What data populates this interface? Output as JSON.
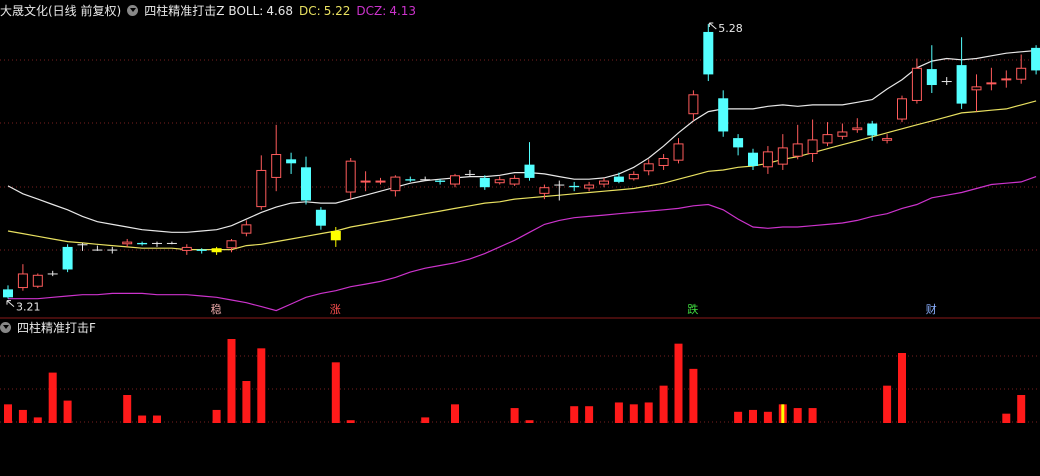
{
  "header": {
    "title": "大晟文化(日线 前复权)",
    "indicator_name": "四柱精准打击Z",
    "boll_label": "BOLL:",
    "boll_value": "4.68",
    "dc_label": "DC:",
    "dc_value": "5.22",
    "dcz_label": "DCZ:",
    "dcz_value": "4.13"
  },
  "sub_header": {
    "indicator_name": "四柱精准打击F"
  },
  "colors": {
    "up": "#ff5c5c",
    "down": "#54ffff",
    "signal": "#ffff00",
    "boll": "#e8e8e8",
    "dc": "#e8e060",
    "dcz": "#cc33cc",
    "volume": "#ff1a1a"
  },
  "markers": [
    {
      "text": "稳",
      "index": 14,
      "color": "#e8a8a8"
    },
    {
      "text": "涨",
      "index": 22,
      "color": "#ff5050"
    },
    {
      "text": "跌",
      "index": 46,
      "color": "#40dd40"
    },
    {
      "text": "财",
      "index": 62,
      "color": "#8ab0ff"
    }
  ],
  "chart_data": [
    {
      "type": "candlestick",
      "price_range": [
        3.2,
        5.31
      ],
      "annotations": {
        "high_label": "5.28",
        "low_label": "3.21"
      },
      "candles": [
        [
          3.28,
          3.22,
          3.31,
          3.21
        ],
        [
          3.29,
          3.4,
          3.47,
          3.27
        ],
        [
          3.3,
          3.39,
          3.4,
          3.29
        ],
        [
          3.4,
          3.4,
          3.42,
          3.38
        ],
        [
          3.6,
          3.43,
          3.62,
          3.41
        ],
        [
          3.62,
          3.62,
          3.63,
          3.57
        ],
        [
          3.58,
          3.58,
          3.61,
          3.57
        ],
        [
          3.58,
          3.58,
          3.6,
          3.55
        ],
        [
          3.62,
          3.64,
          3.66,
          3.6
        ],
        [
          3.63,
          3.62,
          3.64,
          3.61
        ],
        [
          3.63,
          3.63,
          3.64,
          3.6
        ],
        [
          3.63,
          3.63,
          3.64,
          3.62
        ],
        [
          3.57,
          3.6,
          3.62,
          3.54
        ],
        [
          3.58,
          3.57,
          3.59,
          3.55
        ],
        [
          3.59,
          3.56,
          3.6,
          3.54
        ],
        [
          3.59,
          3.65,
          3.66,
          3.56
        ],
        [
          3.7,
          3.77,
          3.8,
          3.68
        ],
        [
          3.9,
          4.18,
          4.29,
          3.88
        ],
        [
          4.12,
          4.3,
          4.52,
          4.02
        ],
        [
          4.26,
          4.23,
          4.31,
          4.15
        ],
        [
          4.2,
          3.95,
          4.28,
          3.92
        ],
        [
          3.88,
          3.76,
          3.9,
          3.73
        ],
        [
          3.72,
          3.65,
          3.75,
          3.6
        ],
        [
          4.01,
          4.25,
          4.27,
          3.96
        ],
        [
          4.09,
          4.1,
          4.17,
          4.02
        ],
        [
          4.09,
          4.1,
          4.12,
          4.07
        ],
        [
          4.02,
          4.13,
          4.14,
          3.98
        ],
        [
          4.11,
          4.1,
          4.13,
          4.09
        ],
        [
          4.11,
          4.11,
          4.13,
          4.1
        ],
        [
          4.1,
          4.09,
          4.11,
          4.07
        ],
        [
          4.07,
          4.14,
          4.15,
          4.05
        ],
        [
          4.15,
          4.15,
          4.18,
          4.13
        ],
        [
          4.12,
          4.05,
          4.14,
          4.03
        ],
        [
          4.08,
          4.11,
          4.13,
          4.07
        ],
        [
          4.07,
          4.12,
          4.14,
          4.06
        ],
        [
          4.22,
          4.12,
          4.39,
          4.1
        ],
        [
          4.0,
          4.05,
          4.07,
          3.96
        ],
        [
          4.07,
          4.07,
          4.1,
          3.95
        ],
        [
          4.06,
          4.05,
          4.09,
          4.02
        ],
        [
          4.04,
          4.07,
          4.09,
          4.02
        ],
        [
          4.07,
          4.1,
          4.12,
          4.05
        ],
        [
          4.13,
          4.09,
          4.16,
          4.08
        ],
        [
          4.11,
          4.15,
          4.17,
          4.1
        ],
        [
          4.17,
          4.23,
          4.26,
          4.14
        ],
        [
          4.21,
          4.27,
          4.3,
          4.18
        ],
        [
          4.25,
          4.38,
          4.42,
          4.23
        ],
        [
          4.6,
          4.75,
          4.78,
          4.55
        ],
        [
          5.22,
          4.9,
          5.28,
          4.85
        ],
        [
          4.72,
          4.47,
          4.78,
          4.43
        ],
        [
          4.42,
          4.35,
          4.45,
          4.29
        ],
        [
          4.31,
          4.21,
          4.34,
          4.18
        ],
        [
          4.2,
          4.32,
          4.36,
          4.15
        ],
        [
          4.22,
          4.35,
          4.45,
          4.18
        ],
        [
          4.28,
          4.38,
          4.52,
          4.26
        ],
        [
          4.3,
          4.41,
          4.56,
          4.24
        ],
        [
          4.38,
          4.45,
          4.54,
          4.36
        ],
        [
          4.43,
          4.47,
          4.53,
          4.41
        ],
        [
          4.48,
          4.5,
          4.57,
          4.46
        ],
        [
          4.53,
          4.44,
          4.55,
          4.4
        ],
        [
          4.4,
          4.42,
          4.45,
          4.38
        ],
        [
          4.56,
          4.72,
          4.74,
          4.54
        ],
        [
          4.7,
          4.95,
          5.02,
          4.68
        ],
        [
          4.94,
          4.82,
          5.12,
          4.76
        ],
        [
          4.85,
          4.85,
          4.88,
          4.82
        ],
        [
          4.97,
          4.68,
          5.18,
          4.64
        ],
        [
          4.78,
          4.81,
          4.9,
          4.62
        ],
        [
          4.83,
          4.84,
          4.95,
          4.78
        ],
        [
          4.86,
          4.87,
          4.93,
          4.8
        ],
        [
          4.86,
          4.95,
          5.05,
          4.83
        ],
        [
          5.1,
          4.93,
          5.12,
          4.9
        ]
      ],
      "signal_candles": [
        14,
        22
      ],
      "lines": [
        {
          "name": "BOLL",
          "values": [
            4.06,
            4.0,
            3.96,
            3.92,
            3.88,
            3.83,
            3.79,
            3.77,
            3.75,
            3.73,
            3.72,
            3.71,
            3.71,
            3.72,
            3.73,
            3.76,
            3.81,
            3.86,
            3.9,
            3.93,
            3.94,
            3.93,
            3.93,
            3.96,
            3.99,
            4.02,
            4.05,
            4.08,
            4.1,
            4.11,
            4.12,
            4.13,
            4.13,
            4.14,
            4.16,
            4.16,
            4.15,
            4.13,
            4.11,
            4.11,
            4.12,
            4.15,
            4.2,
            4.27,
            4.36,
            4.46,
            4.55,
            4.62,
            4.64,
            4.64,
            4.64,
            4.66,
            4.67,
            4.66,
            4.67,
            4.67,
            4.67,
            4.69,
            4.71,
            4.79,
            4.86,
            4.95,
            5.0,
            5.02,
            5.01,
            5.02,
            5.04,
            5.06,
            5.07,
            5.08
          ]
        },
        {
          "name": "DC",
          "values": [
            3.72,
            3.7,
            3.68,
            3.66,
            3.64,
            3.63,
            3.62,
            3.61,
            3.6,
            3.59,
            3.59,
            3.59,
            3.58,
            3.58,
            3.58,
            3.58,
            3.61,
            3.62,
            3.64,
            3.66,
            3.68,
            3.7,
            3.72,
            3.75,
            3.77,
            3.79,
            3.81,
            3.83,
            3.85,
            3.87,
            3.89,
            3.91,
            3.93,
            3.94,
            3.96,
            3.97,
            3.98,
            3.99,
            4.0,
            4.01,
            4.02,
            4.03,
            4.04,
            4.06,
            4.08,
            4.11,
            4.14,
            4.17,
            4.18,
            4.2,
            4.21,
            4.23,
            4.26,
            4.28,
            4.31,
            4.34,
            4.37,
            4.4,
            4.43,
            4.46,
            4.49,
            4.52,
            4.55,
            4.58,
            4.61,
            4.62,
            4.63,
            4.64,
            4.67,
            4.7
          ]
        },
        {
          "name": "DCZ",
          "values": [
            3.21,
            3.21,
            3.21,
            3.22,
            3.23,
            3.24,
            3.24,
            3.25,
            3.25,
            3.25,
            3.24,
            3.24,
            3.24,
            3.23,
            3.22,
            3.2,
            3.18,
            3.15,
            3.12,
            3.17,
            3.22,
            3.25,
            3.27,
            3.3,
            3.32,
            3.34,
            3.37,
            3.41,
            3.44,
            3.46,
            3.48,
            3.51,
            3.55,
            3.6,
            3.65,
            3.71,
            3.77,
            3.8,
            3.82,
            3.83,
            3.84,
            3.85,
            3.86,
            3.87,
            3.88,
            3.89,
            3.91,
            3.92,
            3.88,
            3.81,
            3.75,
            3.74,
            3.75,
            3.75,
            3.76,
            3.77,
            3.78,
            3.8,
            3.83,
            3.85,
            3.89,
            3.92,
            3.97,
            3.99,
            4.01,
            4.04,
            4.07,
            4.08,
            4.09,
            4.13
          ]
        }
      ]
    },
    {
      "type": "bar",
      "name": "四柱精准打击F",
      "y_range": [
        0,
        90
      ],
      "values": [
        20,
        14,
        6,
        54,
        24,
        0,
        0,
        0,
        30,
        8,
        8,
        0,
        0,
        0,
        14,
        90,
        45,
        80,
        0,
        0,
        0,
        0,
        65,
        3,
        0,
        0,
        0,
        0,
        6,
        0,
        20,
        0,
        0,
        0,
        16,
        3,
        0,
        0,
        18,
        18,
        0,
        22,
        20,
        22,
        40,
        85,
        58,
        0,
        0,
        12,
        14,
        12,
        20,
        16,
        16,
        0,
        0,
        0,
        0,
        40,
        75,
        0,
        0,
        0,
        0,
        0,
        0,
        10,
        30,
        0
      ],
      "highlight_bar": 52
    }
  ]
}
